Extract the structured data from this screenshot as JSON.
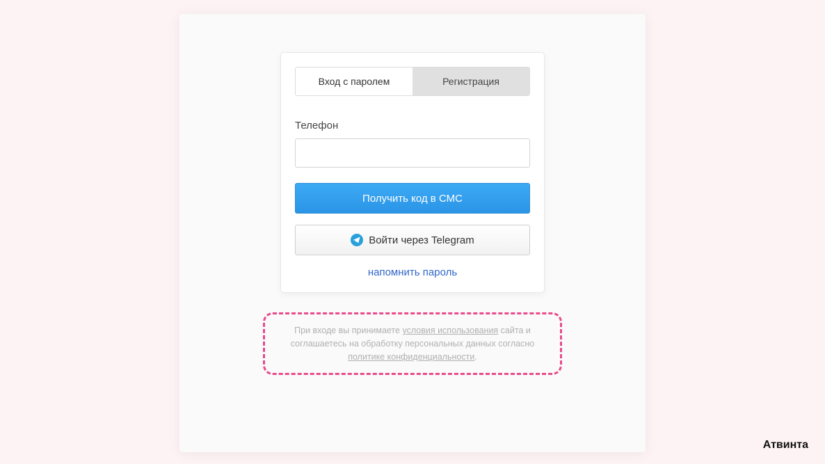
{
  "tabs": {
    "login": "Вход с паролем",
    "register": "Регистрация"
  },
  "form": {
    "phone_label": "Телефон",
    "submit_label": "Получить код в СМС",
    "telegram_label": "Войти через Telegram",
    "remind_label": "напомнить пароль"
  },
  "terms": {
    "part1": "При входе вы принимаете ",
    "terms_link": "условия использования",
    "part2": " сайта и соглашаетесь на обработку персональных данных согласно ",
    "privacy_link": "политике конфиденциальности",
    "period": "."
  },
  "brand": "Атвинта"
}
